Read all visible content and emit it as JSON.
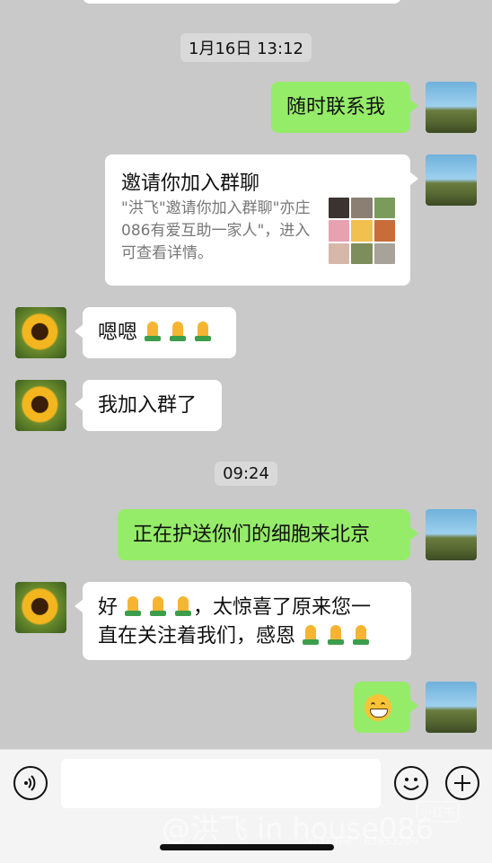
{
  "timestamps": [
    "1月16日 13:12",
    "09:24"
  ],
  "messages": {
    "m1": {
      "text": "随时联系我"
    },
    "invite": {
      "title": "邀请你加入群聊",
      "desc": "\"洪飞\"邀请你加入群聊\"亦庄086有爱互助一家人\"，进入可查看详情。"
    },
    "m2": {
      "text": "嗯嗯"
    },
    "m3": {
      "text": "我加入群了"
    },
    "m4": {
      "text": "正在护送你们的细胞来北京"
    },
    "m5": {
      "line1": "好",
      "line1b": "，太惊喜了原来您一",
      "line2": "直在关注着我们，感恩"
    }
  },
  "watermarks": {
    "author": "@洪飞 in house086",
    "app": "小红书",
    "app_id": "小红书号：63853209"
  },
  "icons": [
    "voice-icon",
    "emoji-icon",
    "plus-icon",
    "praying-hands-icon",
    "grinning-face-icon"
  ],
  "colors": {
    "outgoing": "#95ec69",
    "incoming": "#ffffff",
    "background": "#c9c9c9"
  }
}
